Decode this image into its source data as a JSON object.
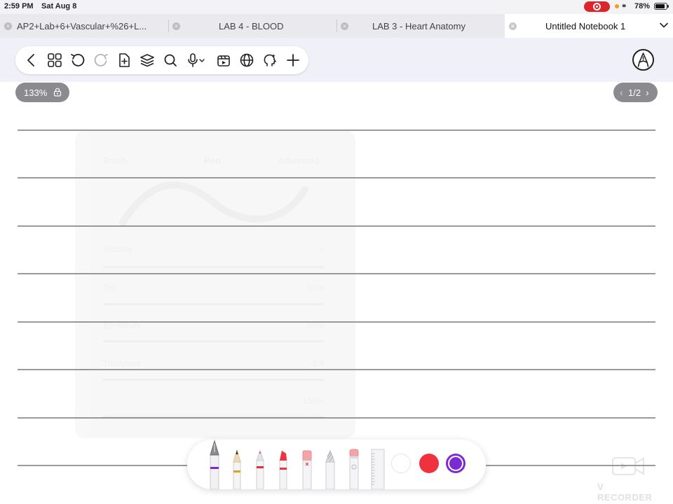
{
  "status_bar": {
    "time": "2:59 PM",
    "date": "Sat Aug 8",
    "battery": "78%",
    "record_color": "#d9262b"
  },
  "tabs": [
    {
      "label": "AP2+Lab+6+Vascular+%26+L...",
      "active": false
    },
    {
      "label": "LAB 4 - BLOOD",
      "active": false
    },
    {
      "label": "LAB 3 - Heart Anatomy",
      "active": false
    },
    {
      "label": "Untitled Notebook 1",
      "active": true
    }
  ],
  "toolbar": {
    "icons": [
      "back-icon",
      "thumbnails-icon",
      "undo-icon",
      "redo-icon",
      "add-page-icon",
      "layers-icon",
      "search-icon",
      "microphone-icon",
      "media-icon",
      "web-icon",
      "ai-assistant-icon",
      "add-icon"
    ],
    "pen_mode_icon": "pen-mode-icon"
  },
  "canvas": {
    "zoom": "133%",
    "page_indicator": "1/2"
  },
  "pen_settings_ghost": {
    "tabs": [
      "Brush",
      "Pen",
      "Advanced"
    ],
    "rows": [
      {
        "label": "Stability",
        "value": "1"
      },
      {
        "label": "Tip",
        "value": "50%"
      },
      {
        "label": "Sensitivity",
        "value": "25%"
      },
      {
        "label": "Thickness",
        "value": "2.9"
      },
      {
        "label": "",
        "value": "100%"
      }
    ]
  },
  "palette": {
    "tools": [
      "fountain-pen-icon",
      "pencil-icon",
      "fine-pen-icon",
      "marker-icon",
      "eraser-icon",
      "texture-brush-icon",
      "lasso-eraser-icon",
      "ruler-icon"
    ],
    "colors": [
      "#ffffff",
      "#f0323f",
      "#7b2ad4"
    ],
    "selected_color": "#7b2ad4"
  },
  "watermark": {
    "label": "V RECORDER"
  }
}
